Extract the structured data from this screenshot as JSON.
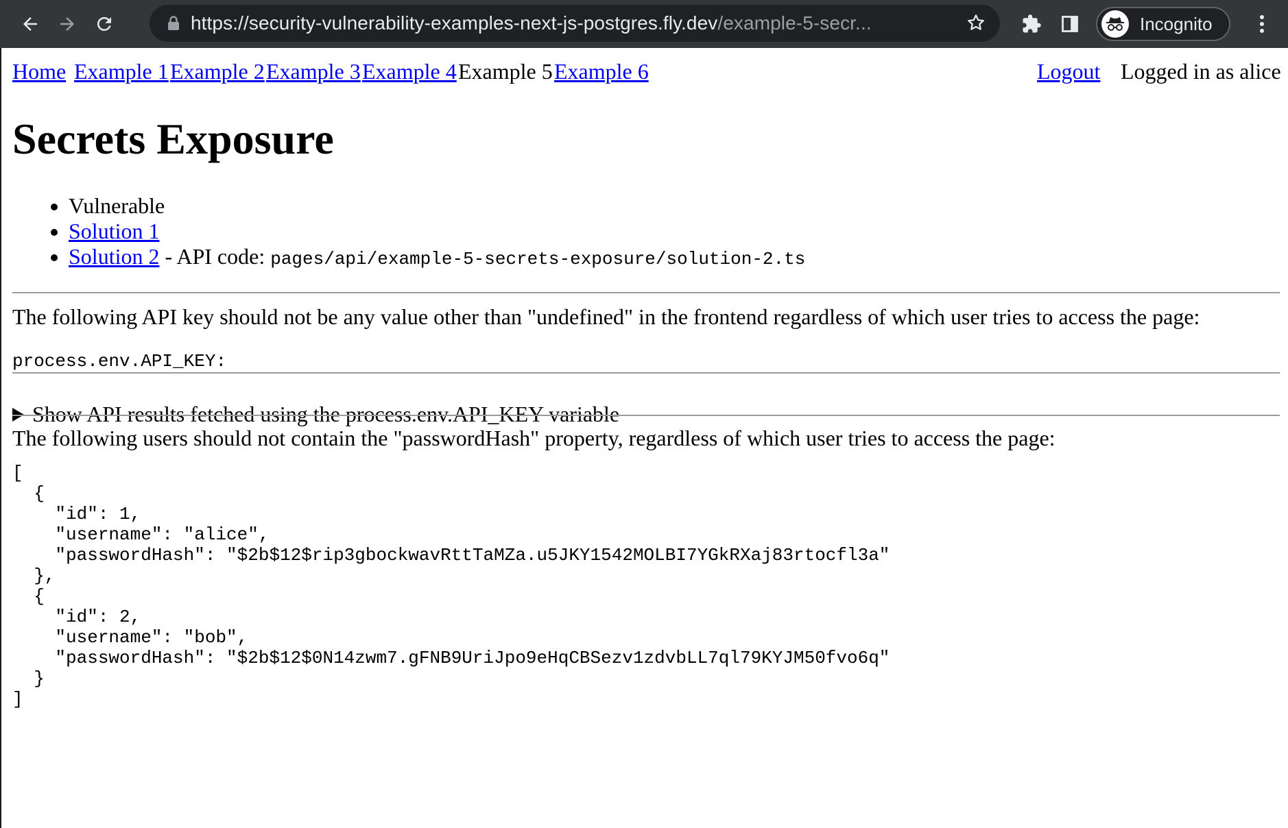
{
  "browser": {
    "url_main": "https://security-vulnerability-examples-next-js-postgres.fly.dev",
    "url_dim": "/example-5-secr...",
    "profile_label": "Incognito"
  },
  "nav": {
    "home": "Home",
    "ex1": "Example 1",
    "ex2": "Example 2",
    "ex3": "Example 3",
    "ex4": "Example 4",
    "ex5": "Example 5",
    "ex6": "Example 6",
    "logout": "Logout",
    "logged_in": "Logged in as alice"
  },
  "page": {
    "title": "Secrets Exposure",
    "solutions": {
      "vulnerable": "Vulnerable",
      "solution1": "Solution 1",
      "solution2": "Solution 2",
      "api_code_label": " - API code: ",
      "api_code_path": "pages/api/example-5-secrets-exposure/solution-2.ts"
    },
    "api_key_note": "The following API key should not be any value other than \"undefined\" in the frontend regardless of which user tries to access the page:",
    "api_key_line": "process.env.API_KEY:",
    "details_summary": "Show API results fetched using the process.env.API_KEY variable",
    "users_note": "The following users should not contain the \"passwordHash\" property, regardless of which user tries to access the page:",
    "users_json": "[\n  {\n    \"id\": 1,\n    \"username\": \"alice\",\n    \"passwordHash\": \"$2b$12$rip3gbockwavRttTaMZa.u5JKY1542MOLBI7YGkRXaj83rtocfl3a\"\n  },\n  {\n    \"id\": 2,\n    \"username\": \"bob\",\n    \"passwordHash\": \"$2b$12$0N14zwm7.gFNB9UriJpo9eHqCBSezv1zdvbLL7ql79KYJM50fvo6q\"\n  }\n]"
  }
}
